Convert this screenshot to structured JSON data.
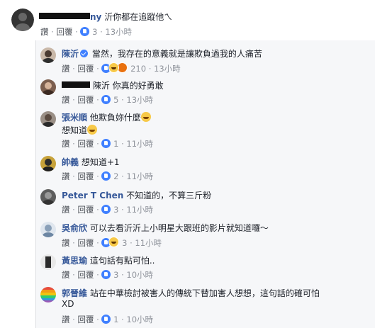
{
  "top_comment": {
    "author_suffix": "ny",
    "text": "沂你都在追蹤他ㄟ",
    "actions": {
      "like": "讚",
      "reply": "回覆",
      "count": "3",
      "time": "13小時"
    }
  },
  "replies": [
    {
      "author": "陳沂",
      "text": "當然，我存在的意義就是讓欺負過我的人痛苦",
      "verified": true,
      "like": "讚",
      "reply": "回覆",
      "count": "210",
      "time": "13小時",
      "reactions": [
        "like",
        "haha",
        "angry"
      ]
    },
    {
      "author": "",
      "text": "陳沂 你真的好勇敢",
      "like": "讚",
      "reply": "回覆",
      "count": "5",
      "time": "13小時",
      "reactions": [
        "like"
      ]
    },
    {
      "author": "張米順",
      "text": "他欺負妳什麼",
      "text2": "想知道",
      "like": "讚",
      "reply": "回覆",
      "count": "1",
      "time": "11小時",
      "reactions": [
        "like"
      ]
    },
    {
      "author": "帥義",
      "text": "想知道+1",
      "like": "讚",
      "reply": "回覆",
      "count": "2",
      "time": "11小時",
      "reactions": [
        "like"
      ]
    },
    {
      "author": "Peter T Chen",
      "text": "不知道的，不算三斤粉",
      "like": "讚",
      "reply": "回覆",
      "count": "3",
      "time": "11小時",
      "reactions": [
        "like"
      ]
    },
    {
      "author": "吳俞欣",
      "text": "可以去看沂沂上小明星大跟班的影片就知道囉～",
      "like": "讚",
      "reply": "回覆",
      "count": "3",
      "time": "11小時",
      "reactions": [
        "like",
        "haha"
      ]
    },
    {
      "author": "黃思瑜",
      "text": "這句話有點可怕..",
      "like": "讚",
      "reply": "回覆",
      "count": "3",
      "time": "10小時",
      "reactions": [
        "like"
      ]
    },
    {
      "author": "郭晉維",
      "text": "站在中華檢討被害人的傳統下替加害人想想，這句話的確可怕",
      "text2": "XD",
      "like": "讚",
      "reply": "回覆",
      "count": "1",
      "time": "10小時",
      "reactions": [
        "like"
      ]
    }
  ],
  "colors": {
    "link": "#365899",
    "meta": "#90949c",
    "like_blue": "#4080ff",
    "thread_bg": "#f6f7f9"
  }
}
